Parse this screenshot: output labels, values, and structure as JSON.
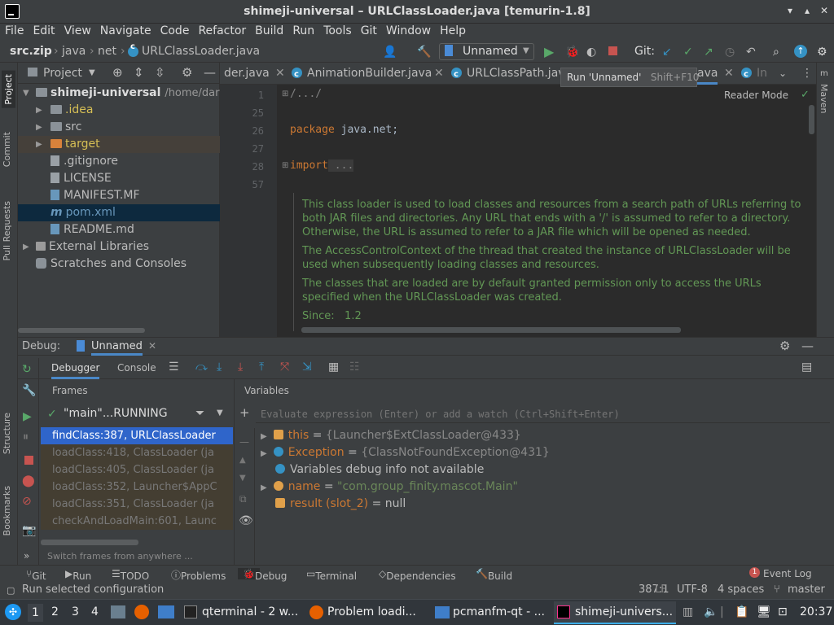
{
  "window": {
    "title": "shimeji-universal – URLClassLoader.java [temurin-1.8]"
  },
  "menu": [
    "File",
    "Edit",
    "View",
    "Navigate",
    "Code",
    "Refactor",
    "Build",
    "Run",
    "Tools",
    "Git",
    "Window",
    "Help"
  ],
  "breadcrumbs": [
    "src.zip",
    "java",
    "net",
    "URLClassLoader.java"
  ],
  "toolbar": {
    "run_config": "Unnamed",
    "git_label": "Git:"
  },
  "tooltip": {
    "text": "Run 'Unnamed'",
    "shortcut": "Shift+F10"
  },
  "project": {
    "header": "Project",
    "rows": [
      {
        "label": "shimeji-universal",
        "extra": "/home/dartz"
      },
      {
        "label": ".idea"
      },
      {
        "label": "src"
      },
      {
        "label": "target"
      },
      {
        "label": ".gitignore"
      },
      {
        "label": "LICENSE"
      },
      {
        "label": "MANIFEST.MF"
      },
      {
        "label": "pom.xml"
      },
      {
        "label": "README.md"
      },
      {
        "label": "External Libraries"
      },
      {
        "label": "Scratches and Consoles"
      }
    ]
  },
  "editor": {
    "tabs": [
      "der.java",
      "AnimationBuilder.java",
      "URLClassPath.java",
      "ava",
      "In"
    ],
    "reader_mode": "Reader Mode",
    "lines": [
      {
        "n": "1",
        "code": "/.../"
      },
      {
        "n": "25",
        "code": ""
      },
      {
        "n": "26",
        "kw": "package",
        "code": " java.net;"
      },
      {
        "n": "27",
        "code": ""
      },
      {
        "n": "28",
        "kw": "import",
        "code": " ..."
      },
      {
        "n": "57",
        "code": ""
      }
    ],
    "doc": [
      "This class loader is used to load classes and resources from a search path of URLs referring to both JAR files and directories. Any URL that ends with a '/' is assumed to refer to a directory. Otherwise, the URL is assumed to refer to a JAR file which will be opened as needed.",
      "The AccessControlContext of the thread that created the instance of URLClassLoader will be used when subsequently loading classes and resources.",
      "The classes that are loaded are by default granted permission only to access the URLs specified when the URLClassLoader was created."
    ],
    "since_label": "Since:",
    "since_value": "1.2"
  },
  "debug": {
    "label": "Debug:",
    "session": "Unnamed",
    "tabs": [
      "Debugger",
      "Console"
    ],
    "frames_label": "Frames",
    "thread": "\"main\"...RUNNING",
    "frames": [
      "findClass:387, URLClassLoader",
      "loadClass:418, ClassLoader (ja",
      "loadClass:405, ClassLoader (ja",
      "loadClass:352, Launcher$AppC",
      "loadClass:351, ClassLoader (ja",
      "checkAndLoadMain:601, Launc"
    ],
    "frames_hint": "Switch frames from anywhere ...",
    "variables_label": "Variables",
    "eval_placeholder": "Evaluate expression (Enter) or add a watch (Ctrl+Shift+Enter)",
    "vars": [
      {
        "name": "this",
        "eq": " = ",
        "value": "{Launcher$ExtClassLoader@433}",
        "icon": "#e0a04a"
      },
      {
        "name": "Exception",
        "eq": " = ",
        "value": "{ClassNotFoundException@431}",
        "icon": "#3592c4"
      },
      {
        "name": "Variables debug info not available",
        "eq": "",
        "value": "",
        "icon": "#3592c4"
      },
      {
        "name": "name",
        "eq": " = ",
        "value": "\"com.group_finity.mascot.Main\"",
        "icon": "#e0a04a"
      },
      {
        "name": "result (slot_2)",
        "eq": " = ",
        "value": "null",
        "icon": "#e0a04a"
      }
    ]
  },
  "bottom_tabs": [
    "Git",
    "Run",
    "TODO",
    "Problems",
    "Debug",
    "Terminal",
    "Dependencies",
    "Build"
  ],
  "event_log": {
    "count": "1",
    "label": "Event Log"
  },
  "status": {
    "message": "Run selected configuration",
    "position": "387:1",
    "line_sep": "LF",
    "encoding": "UTF-8",
    "indent": "4 spaces",
    "branch": "master"
  },
  "left_stripe": [
    "Project",
    "Commit",
    "Pull Requests",
    "Structure",
    "Bookmarks"
  ],
  "right_stripe": [
    "Maven"
  ],
  "taskbar": {
    "desktops": [
      "1",
      "2",
      "3",
      "4"
    ],
    "tasks": [
      "qterminal - 2 w...",
      "Problem loadi...",
      "pcmanfm-qt - ...",
      "shimeji-univers..."
    ],
    "clock": "20:37"
  }
}
